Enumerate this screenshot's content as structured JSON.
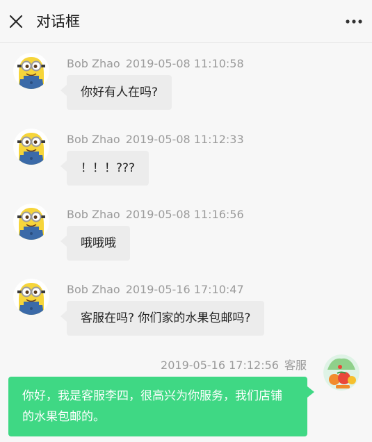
{
  "header": {
    "title": "对话框",
    "close_icon": "close-icon",
    "more_icon": "more-horizontal-icon"
  },
  "messages": [
    {
      "sender": "Bob Zhao",
      "time": "2019-05-08 11:10:58",
      "text": "你好有人在吗?",
      "direction": "incoming"
    },
    {
      "sender": "Bob Zhao",
      "time": "2019-05-08 11:12:33",
      "text": "！！！???",
      "direction": "incoming"
    },
    {
      "sender": "Bob Zhao",
      "time": "2019-05-08 11:16:56",
      "text": "哦哦哦",
      "direction": "incoming"
    },
    {
      "sender": "Bob Zhao",
      "time": "2019-05-16 17:10:47",
      "text": "客服在吗? 你们家的水果包邮吗?",
      "direction": "incoming"
    },
    {
      "sender": "客服",
      "time": "2019-05-16 17:12:56",
      "text": "你好，我是客服李四，很高兴为你服务，我们店铺的水果包邮的。",
      "direction": "outgoing"
    }
  ],
  "colors": {
    "outgoing_bubble": "#3fd884",
    "incoming_bubble": "#ececec",
    "background": "#f7f7f7"
  }
}
